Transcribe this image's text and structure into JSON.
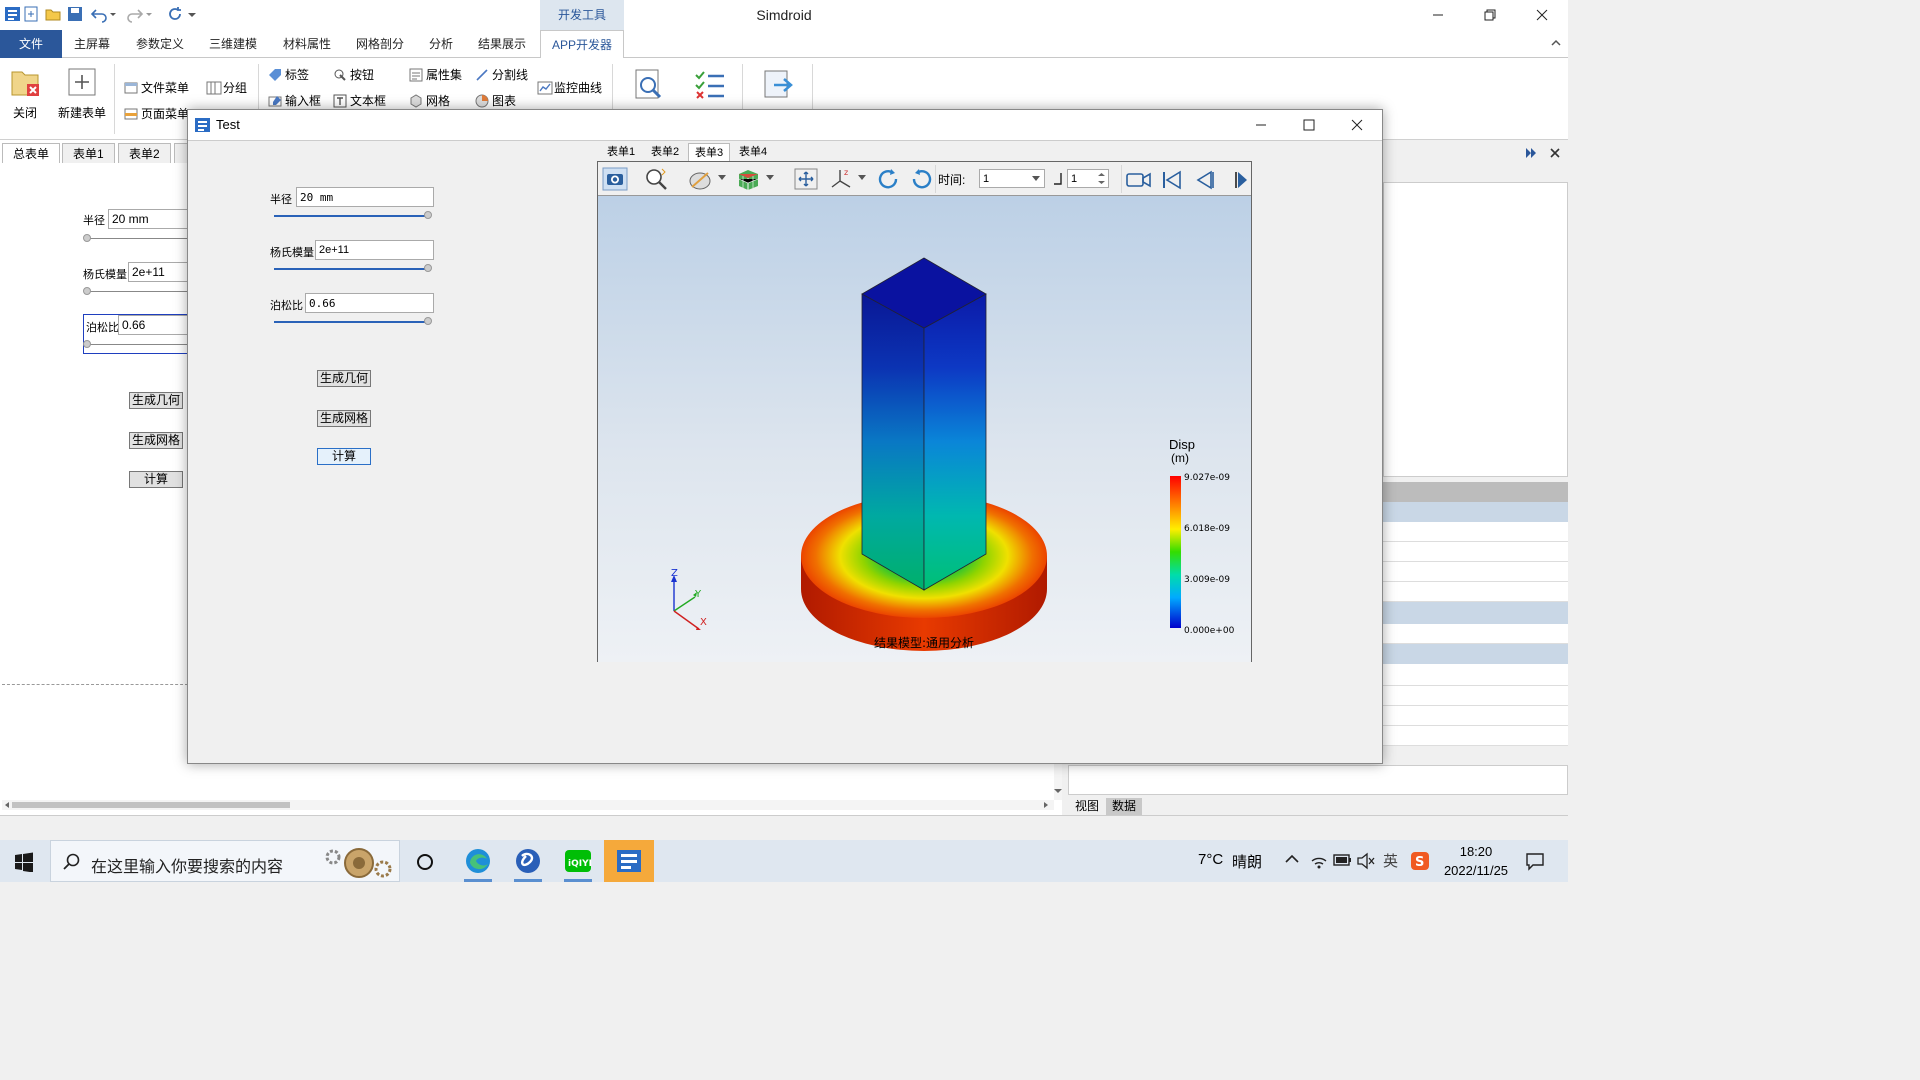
{
  "app": {
    "title": "Simdroid",
    "context_tab": "开发工具"
  },
  "ribbon_tabs": [
    "文件",
    "主屏幕",
    "参数定义",
    "三维建模",
    "材料属性",
    "网格剖分",
    "分析",
    "结果展示",
    "APP开发器"
  ],
  "ribbon": {
    "close_label": "关闭",
    "new_form_label": "新建表单",
    "file_menu": "文件菜单",
    "page_menu": "页面菜单",
    "group": "分组",
    "label": "标签",
    "button": "按钮",
    "input_box": "输入框",
    "text_box": "文本框",
    "property_set": "属性集",
    "divider": "分割线",
    "mesh": "网格",
    "chart": "图表",
    "monitor_curve": "监控曲线"
  },
  "left_panel": {
    "tabs": [
      "总表单",
      "表单1",
      "表单2"
    ],
    "radius_label": "半径",
    "radius_value": "20 mm",
    "young_label": "杨氏模量",
    "young_value": "2e+11",
    "poisson_label": "泊松比",
    "poisson_value": "0.66",
    "btn_geom": "生成几何",
    "btn_mesh": "生成网格",
    "btn_calc": "计算"
  },
  "dialog": {
    "title": "Test",
    "radius_label": "半径",
    "radius_value": "20 mm",
    "young_label": "杨氏模量",
    "young_value": "2e+11",
    "poisson_label": "泊松比",
    "poisson_value": "0.66",
    "btn_geom": "生成几何",
    "btn_mesh": "生成网格",
    "btn_calc": "计算",
    "tabs": [
      "表单1",
      "表单2",
      "表单3",
      "表单4"
    ],
    "active_tab": "表单3"
  },
  "viewer": {
    "time_label": "时间:",
    "time_value": "1",
    "step_value": "1",
    "legend_title": "Disp",
    "legend_unit": "(m)",
    "legend_ticks": [
      "9.027e-09",
      "6.018e-09",
      "3.009e-09",
      "0.000e+00"
    ],
    "model_caption": "结果模型:通用分析",
    "axes": [
      "Z",
      "Y",
      "X"
    ]
  },
  "right_panel": {
    "tabs": [
      "视图",
      "数据"
    ]
  },
  "taskbar": {
    "search_placeholder": "在这里输入你要搜索的内容",
    "weather_temp": "7°C",
    "weather_desc": "晴朗",
    "ime": "英",
    "time": "18:20",
    "date": "2022/11/25"
  }
}
